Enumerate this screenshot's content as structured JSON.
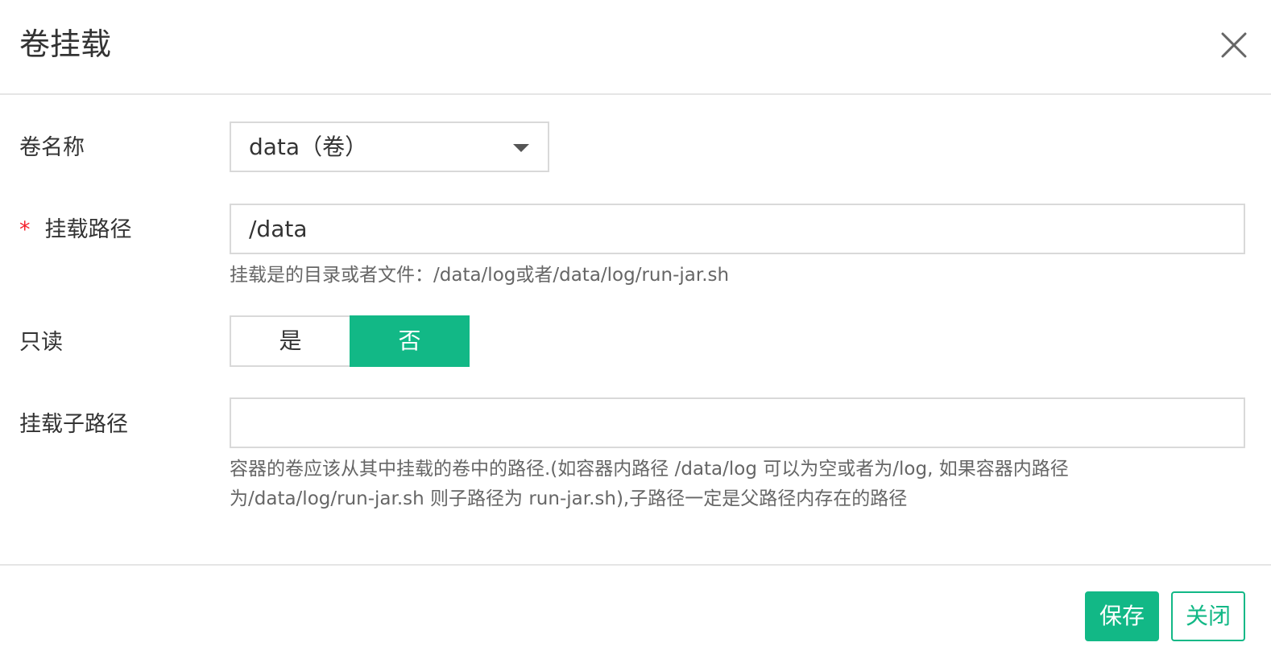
{
  "dialog": {
    "title": "卷挂载"
  },
  "form": {
    "volume_name": {
      "label": "卷名称",
      "value": "data（卷）"
    },
    "mount_path": {
      "required_mark": "*",
      "label": "挂载路径",
      "value": "/data",
      "help": "挂载是的目录或者文件：/data/log或者/data/log/run-jar.sh"
    },
    "read_only": {
      "label": "只读",
      "options": [
        "是",
        "否"
      ],
      "selected": "否"
    },
    "sub_path": {
      "label": "挂载子路径",
      "value": "",
      "help_line1": "容器的卷应该从其中挂载的卷中的路径.(如容器内路径 /data/log 可以为空或者为/log, 如果容器内路径",
      "help_line2": "为/data/log/run-jar.sh 则子路径为 run-jar.sh),子路径一定是父路径内存在的路径"
    }
  },
  "footer": {
    "save_label": "保存",
    "close_label": "关闭"
  },
  "icons": {
    "close": "close-icon",
    "dropdown": "caret-down-icon"
  },
  "colors": {
    "accent": "#12b886",
    "required": "#f5222d",
    "border": "#d9d9d9"
  }
}
